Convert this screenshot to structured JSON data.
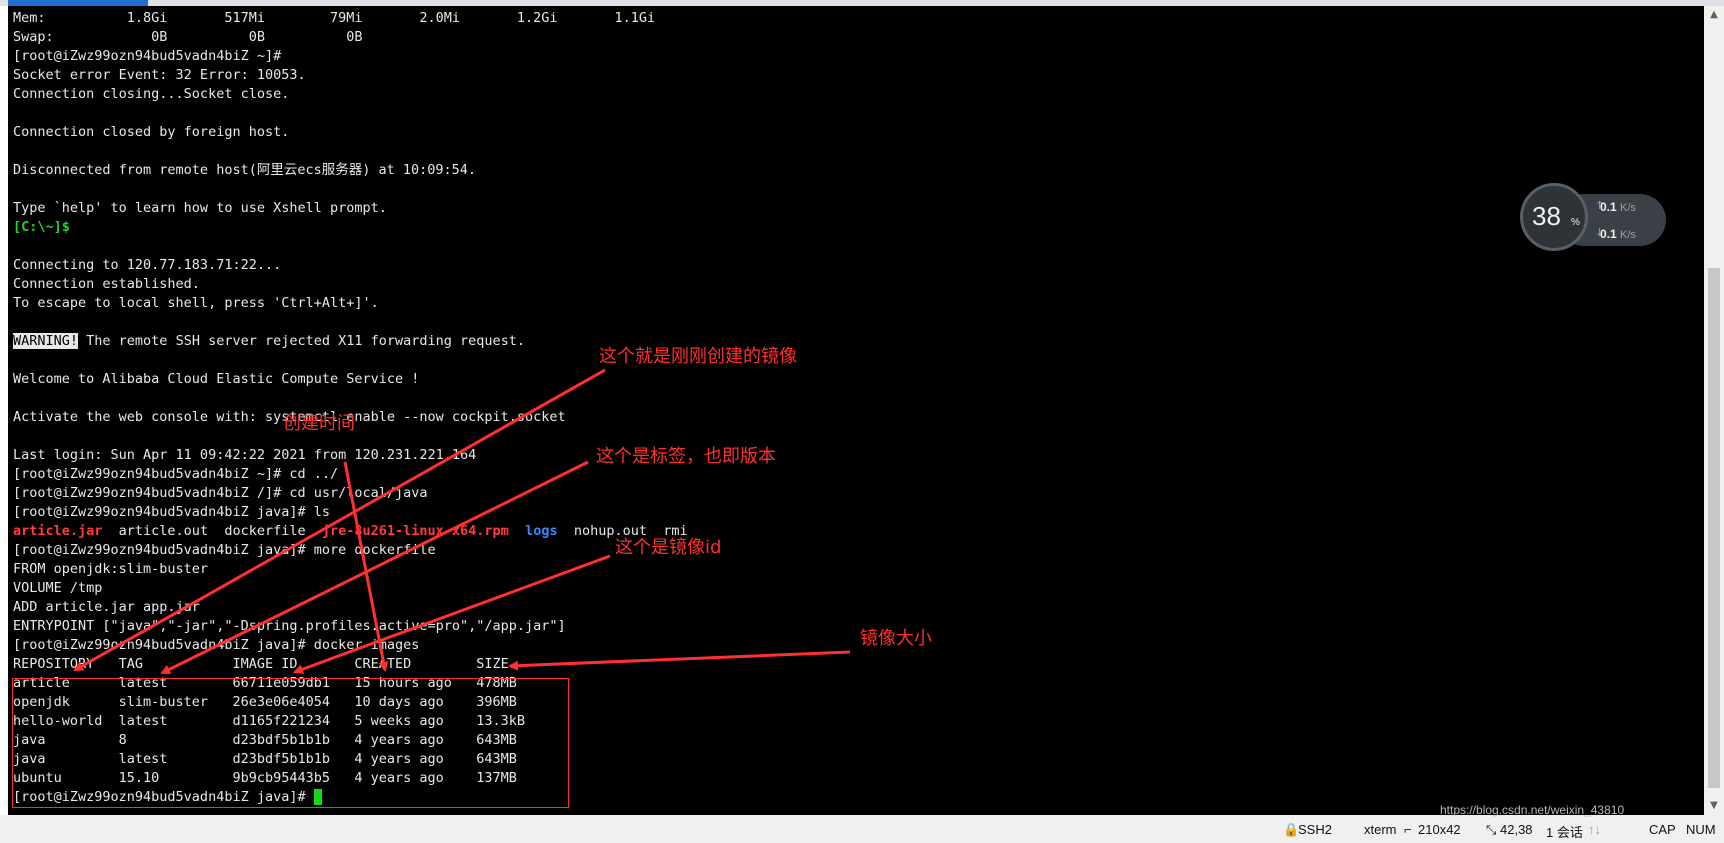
{
  "terminal_lines": [
    "Mem:          1.8Gi       517Mi        79Mi       2.0Mi       1.2Gi       1.1Gi",
    "Swap:            0B          0B          0B",
    "[root@iZwz99ozn94bud5vadn4biZ ~]#",
    "Socket error Event: 32 Error: 10053.",
    "Connection closing...Socket close.",
    "",
    "Connection closed by foreign host.",
    "",
    "Disconnected from remote host(阿里云ecs服务器) at 10:09:54.",
    "",
    "Type `help' to learn how to use Xshell prompt."
  ],
  "local_prompt": "[C:\\~]$",
  "connect_lines": [
    "",
    "Connecting to 120.77.183.71:22...",
    "Connection established.",
    "To escape to local shell, press 'Ctrl+Alt+]'.",
    ""
  ],
  "warning_label": "WARNING!",
  "warning_text": " The remote SSH server rejected X11 forwarding request.",
  "session_lines": [
    "",
    "Welcome to Alibaba Cloud Elastic Compute Service !",
    "",
    "Activate the web console with: systemctl enable --now cockpit.socket",
    "",
    "Last login: Sun Apr 11 09:42:22 2021 from 120.231.221.164",
    "[root@iZwz99ozn94bud5vadn4biZ ~]# cd ../",
    "[root@iZwz99ozn94bud5vadn4biZ /]# cd usr/local/java",
    "[root@iZwz99ozn94bud5vadn4biZ java]# ls"
  ],
  "ls_output": {
    "article_jar": "article.jar",
    "middle": "  article.out  dockerfile  ",
    "jre_rpm": "jre-8u261-linux-x64.rpm",
    "gap": "  ",
    "logs": "logs",
    "tail": "  nohup.out  rmi"
  },
  "docker_lines": [
    "[root@iZwz99ozn94bud5vadn4biZ java]# more dockerfile",
    "FROM openjdk:slim-buster",
    "VOLUME /tmp",
    "ADD article.jar app.jar",
    "ENTRYPOINT [\"java\",\"-jar\",\"-Dspring.profiles.active=pro\",\"/app.jar\"]",
    "[root@iZwz99ozn94bud5vadn4biZ java]# docker images",
    "REPOSITORY   TAG           IMAGE ID       CREATED        SIZE",
    "article      latest        66711e059db1   15 hours ago   478MB",
    "openjdk      slim-buster   26e3e06e4054   10 days ago    396MB",
    "hello-world  latest        d1165f221234   5 weeks ago    13.3kB",
    "java         8             d23bdf5b1b1b   4 years ago    643MB",
    "java         latest        d23bdf5b1b1b   4 years ago    643MB",
    "ubuntu       15.10         9b9cb95443b5   4 years ago    137MB"
  ],
  "final_prompt": "[root@iZwz99ozn94bud5vadn4biZ java]# ",
  "annotations": {
    "just_created": "这个就是刚刚创建的镜像",
    "created_time": "创建时间",
    "tag_version": "这个是标签，也即版本",
    "image_id": "这个是镜像id",
    "image_size": "镜像大小"
  },
  "net_widget": {
    "cpu_percent": "38",
    "percent_sign": "%",
    "up_speed": "0.1",
    "down_speed": "0.1",
    "unit": "K/s"
  },
  "status_bar": {
    "protocol": "SSH2",
    "terminal_type": "xterm",
    "size": "210x42",
    "cursor_pos": "42,38",
    "sessions": "1 会话",
    "cap": "CAP",
    "num": "NUM",
    "watermark": "https://blog.csdn.net/weixin_43810"
  },
  "colors": {
    "terminal_bg": "#000000",
    "terminal_fg": "#e8e8e8",
    "annotation_red": "#ff3030",
    "prompt_green": "#22d322",
    "file_red": "#ff3b3b",
    "dir_blue": "#2f8cff"
  }
}
